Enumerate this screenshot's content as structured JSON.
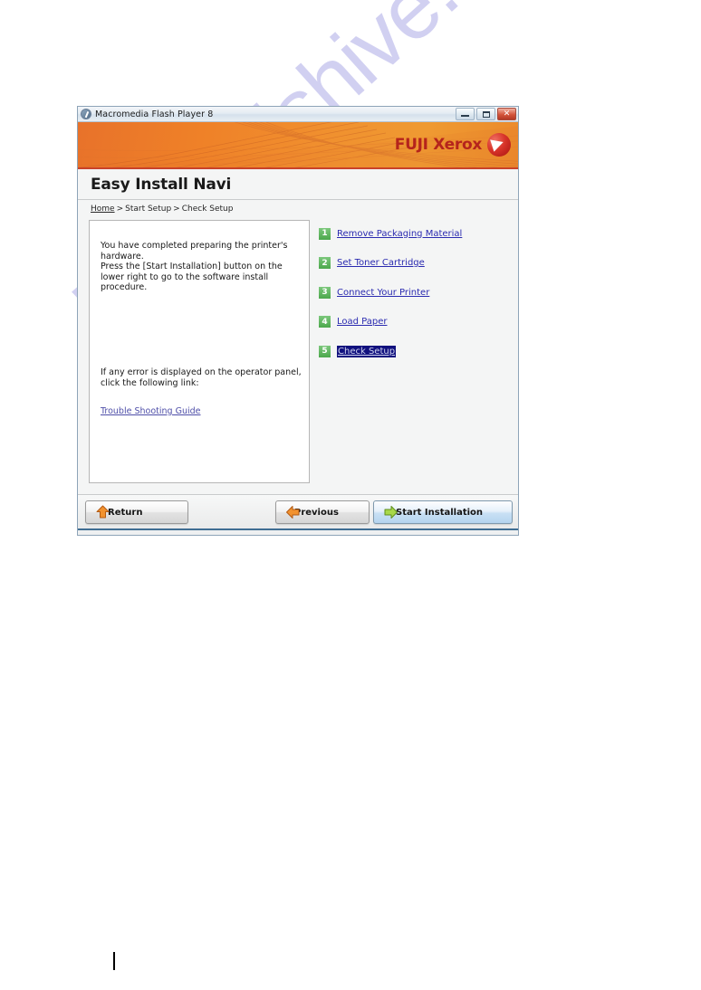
{
  "window": {
    "title": "Macromedia Flash Player 8",
    "icon": "flash-icon",
    "controls": {
      "minimize": "minimize-button",
      "maximize": "maximize-button",
      "close": "close-button",
      "close_glyph": "✕"
    }
  },
  "banner": {
    "brand": "FUJI Xerox",
    "logo_icon": "xerox-ball-icon",
    "accent_color": "#ef8a2b",
    "brand_color": "#b5241c"
  },
  "header": {
    "title": "Easy Install Navi"
  },
  "breadcrumb": {
    "home": "Home",
    "sep1": ">",
    "level2": "Start Setup",
    "sep2": ">",
    "current": "Check Setup"
  },
  "panel": {
    "body_text": "You have completed preparing the printer's hardware.\nPress the [Start Installation] button on the lower right to go to the software install procedure.",
    "error_text": "If any error is displayed on the operator panel,\nclick the following link:",
    "link_label": "Trouble Shooting Guide",
    "link_color": "#4e4ea8"
  },
  "steps": {
    "badge_color": "#5cb85c",
    "link_color": "#2a2ab0",
    "selected_bg": "#11117e",
    "items": [
      {
        "num": "1",
        "label": "Remove Packaging Material",
        "selected": false
      },
      {
        "num": "2",
        "label": "Set Toner Cartridge",
        "selected": false
      },
      {
        "num": "3",
        "label": "Connect Your Printer",
        "selected": false
      },
      {
        "num": "4",
        "label": "Load Paper",
        "selected": false
      },
      {
        "num": "5",
        "label": "Check Setup",
        "selected": true
      }
    ]
  },
  "footer": {
    "return_label": "Return",
    "return_icon": "arrow-up-icon",
    "previous_label": "Previous",
    "previous_icon": "arrow-left-icon",
    "start_label": "Start Installation",
    "start_icon": "arrow-right-icon"
  },
  "watermark": {
    "text": "manualshive.com",
    "color": "#c9c8ef"
  }
}
